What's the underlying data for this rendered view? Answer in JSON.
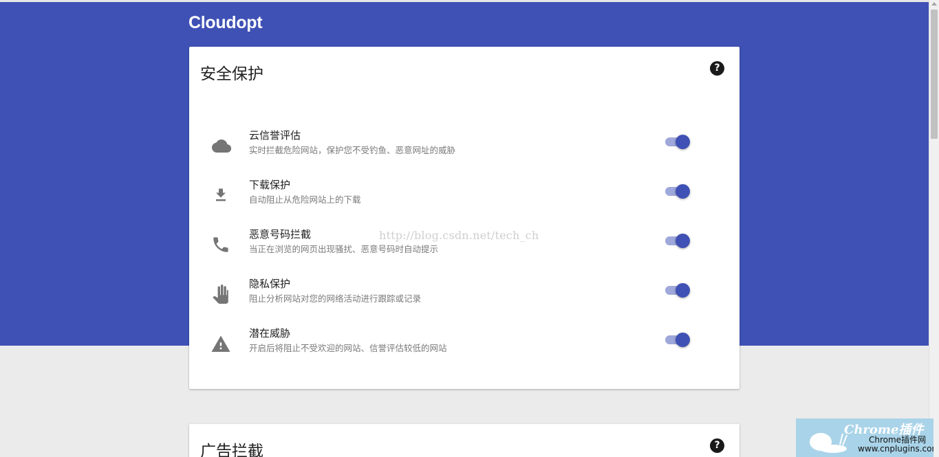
{
  "app": {
    "logo": "Cloudopt"
  },
  "security": {
    "title": "安全保护",
    "help_icon": "?",
    "items": [
      {
        "icon": "cloud-icon",
        "title": "云信誉评估",
        "desc": "实时拦截危险网站，保护您不受钓鱼、恶意网址的威胁",
        "enabled": true
      },
      {
        "icon": "download-icon",
        "title": "下载保护",
        "desc": "自动阻止从危险网站上的下载",
        "enabled": true
      },
      {
        "icon": "phone-icon",
        "title": "恶意号码拦截",
        "desc": "当正在浏览的网页出现骚扰、恶意号码时自动提示",
        "enabled": true
      },
      {
        "icon": "hand-icon",
        "title": "隐私保护",
        "desc": "阻止分析网站对您的网络活动进行跟踪或记录",
        "enabled": true
      },
      {
        "icon": "warning-icon",
        "title": "潜在威胁",
        "desc": "开启后将阻止不受欢迎的网站、信誉评估较低的网站",
        "enabled": true
      }
    ]
  },
  "ads": {
    "title": "广告拦截",
    "help_icon": "?"
  },
  "watermark": "http://blog.csdn.net/tech_ch",
  "badge": {
    "title": "Chrome插件",
    "name": "Chrome插件网",
    "url": "www.cnplugins.com"
  },
  "colors": {
    "primary": "#3f51b5",
    "toggle_track": "#9fa8da",
    "background": "#ebebeb"
  }
}
